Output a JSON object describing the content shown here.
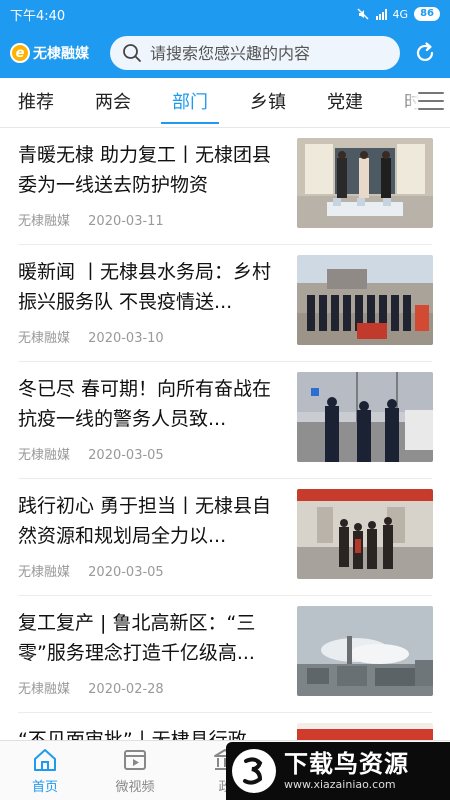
{
  "status_bar": {
    "time": "下午4:40",
    "network": "4G",
    "battery": "86"
  },
  "header": {
    "brand_logo_letter": "e",
    "brand_name": "无棣融媒",
    "search_placeholder": "请搜索您感兴趣的内容",
    "accent_color": "#1e9af0"
  },
  "tabs": [
    {
      "label": "推荐"
    },
    {
      "label": "两会"
    },
    {
      "label": "部门",
      "active": true
    },
    {
      "label": "乡镇"
    },
    {
      "label": "党建"
    },
    {
      "label": "时"
    }
  ],
  "news": [
    {
      "title": "青暖无棣 助力复工丨无棣团县委为一线送去防护物资",
      "source": "无棣融媒",
      "date": "2020-03-11"
    },
    {
      "title": "暖新闻 丨无棣县水务局：乡村振兴服务队 不畏疫情送...",
      "source": "无棣融媒",
      "date": "2020-03-10"
    },
    {
      "title": "冬已尽 春可期！向所有奋战在抗疫一线的警务人员致...",
      "source": "无棣融媒",
      "date": "2020-03-05"
    },
    {
      "title": "践行初心 勇于担当丨无棣县自然资源和规划局全力以...",
      "source": "无棣融媒",
      "date": "2020-03-05"
    },
    {
      "title": "复工复产 | 鲁北高新区：“三零”服务理念打造千亿级高...",
      "source": "无棣融媒",
      "date": "2020-02-28"
    },
    {
      "title": "“不见面审批”丨无棣县行政",
      "source": "",
      "date": ""
    }
  ],
  "bottom_nav": [
    {
      "label": "首页",
      "icon": "home-icon",
      "active": true
    },
    {
      "label": "微视频",
      "icon": "video-icon"
    },
    {
      "label": "政",
      "icon": "government-icon"
    }
  ],
  "watermark": {
    "text": "下载鸟资源",
    "url": "www.xiazainiao.com"
  }
}
